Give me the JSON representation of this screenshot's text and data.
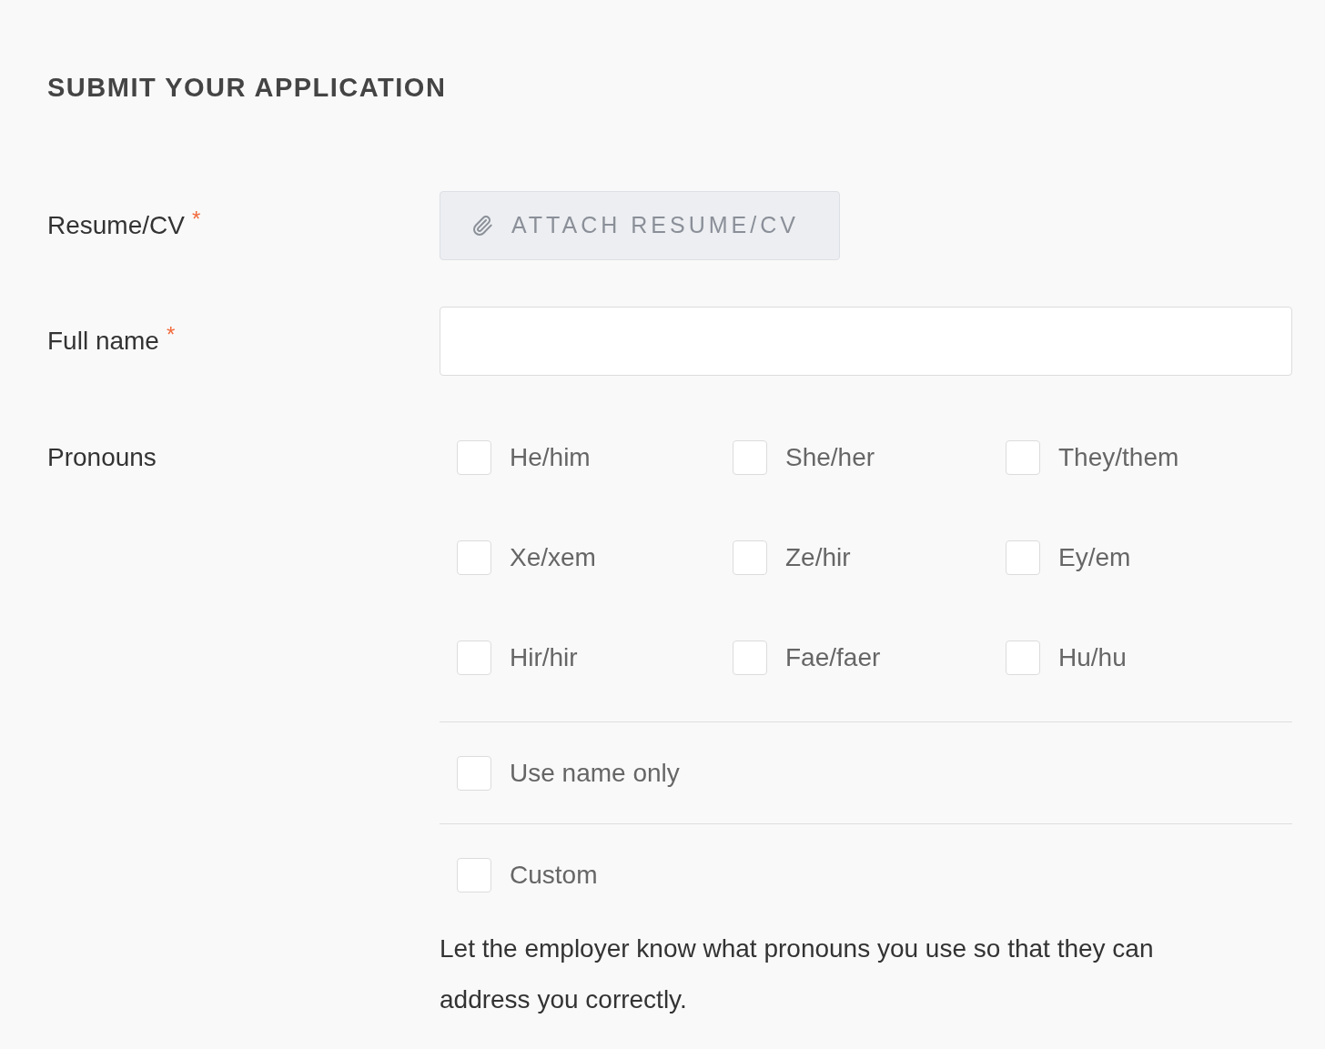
{
  "title": "SUBMIT YOUR APPLICATION",
  "resume": {
    "label": "Resume/CV",
    "required_mark": "*",
    "button": "ATTACH RESUME/CV"
  },
  "full_name": {
    "label": "Full name",
    "required_mark": "*"
  },
  "pronouns": {
    "label": "Pronouns",
    "options": [
      {
        "label": "He/him",
        "checked": false
      },
      {
        "label": "She/her",
        "checked": false
      },
      {
        "label": "They/them",
        "checked": false
      },
      {
        "label": "Xe/xem",
        "checked": false
      },
      {
        "label": "Ze/hir",
        "checked": false
      },
      {
        "label": "Ey/em",
        "checked": false
      },
      {
        "label": "Hir/hir",
        "checked": false
      },
      {
        "label": "Fae/faer",
        "checked": false
      },
      {
        "label": "Hu/hu",
        "checked": false
      }
    ],
    "extra_options": [
      {
        "label": "Use name only",
        "checked": false
      },
      {
        "label": "Custom",
        "checked": false
      }
    ],
    "help": "Let the employer know what pronouns you use so that they can address you correctly."
  }
}
